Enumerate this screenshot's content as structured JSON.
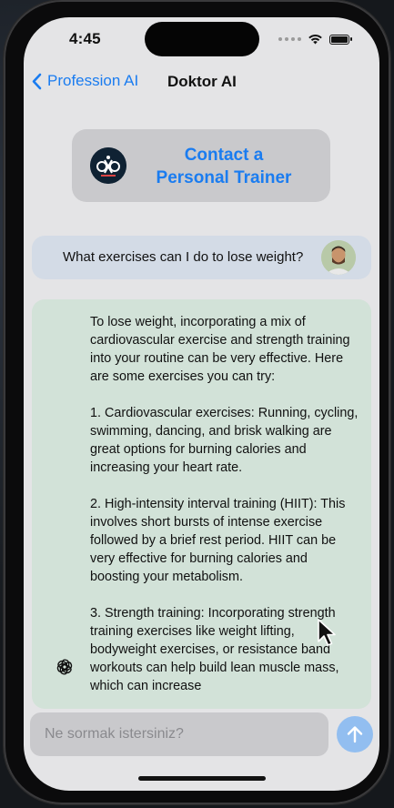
{
  "status": {
    "time": "4:45"
  },
  "nav": {
    "back_label": "Profession AI",
    "title": "Doktor AI"
  },
  "contact": {
    "label": "Contact a\nPersonal Trainer"
  },
  "chat": {
    "user_message": "What exercises can I do to lose weight?",
    "ai_message": "To lose weight, incorporating a mix of cardiovascular exercise and strength training into your routine can be very effective. Here are some exercises you can try:\n\n1. Cardiovascular exercises: Running, cycling, swimming, dancing, and brisk walking are great options for burning calories and increasing your heart rate.\n\n2. High-intensity interval training (HIIT): This involves short bursts of intense exercise followed by a brief rest period. HIIT can be very effective for burning calories and boosting your metabolism.\n\n3. Strength training: Incorporating strength training exercises like weight lifting, bodyweight exercises, or resistance band workouts can help build lean muscle mass, which can increase"
  },
  "input": {
    "placeholder": "Ne sormak istersiniz?",
    "value": ""
  },
  "colors": {
    "accent": "#1a7cf0",
    "ai_bubble": "#d2e2d8",
    "user_bubble": "#d3dbe6",
    "send": "#92bef0"
  },
  "icons": {
    "back": "chevron-left-icon",
    "wifi": "wifi-icon",
    "battery": "battery-icon",
    "ai": "openai-icon",
    "send": "arrow-up-icon"
  }
}
